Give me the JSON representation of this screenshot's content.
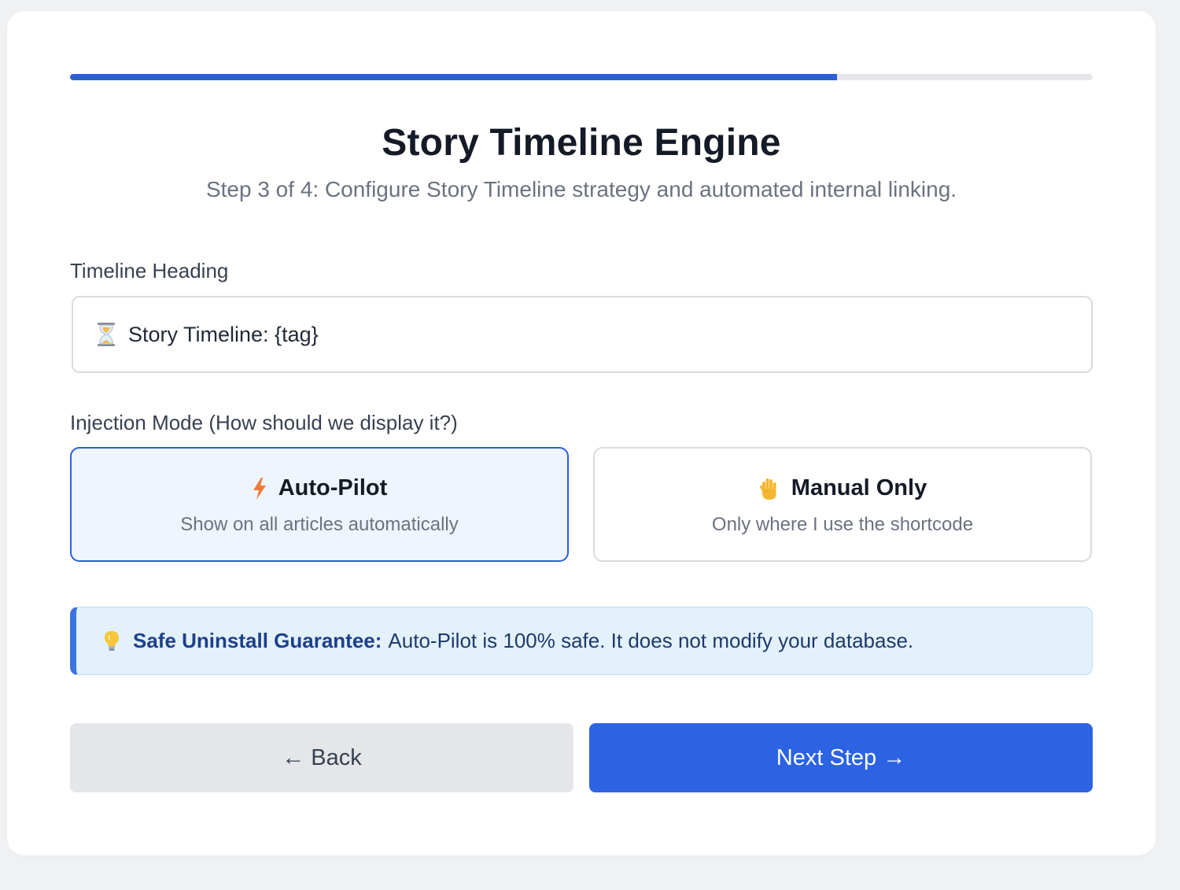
{
  "progress": {
    "fraction": 0.75
  },
  "header": {
    "title": "Story Timeline Engine",
    "subtitle": "Step 3 of 4: Configure Story Timeline strategy and automated internal linking."
  },
  "timeline_heading": {
    "label": "Timeline Heading",
    "icon": "hourglass-icon",
    "value": "Story Timeline: {tag}"
  },
  "injection_mode": {
    "label": "Injection Mode (How should we display it?)",
    "options": [
      {
        "icon": "lightning-icon",
        "title": "Auto-Pilot",
        "description": "Show on all articles automatically",
        "selected": true
      },
      {
        "icon": "raised-hand-icon",
        "title": "Manual Only",
        "description": "Only where I use the shortcode",
        "selected": false
      }
    ]
  },
  "notice": {
    "icon": "lightbulb-icon",
    "strong": "Safe Uninstall Guarantee:",
    "text": "Auto-Pilot is 100% safe. It does not modify your database."
  },
  "buttons": {
    "back": "← Back",
    "next": "Next Step →"
  },
  "colors": {
    "accent": "#2b5fd8",
    "selected_bg": "#eef5ff",
    "notice_bg": "#e3f1fb",
    "notice_border": "#3b74e0"
  }
}
